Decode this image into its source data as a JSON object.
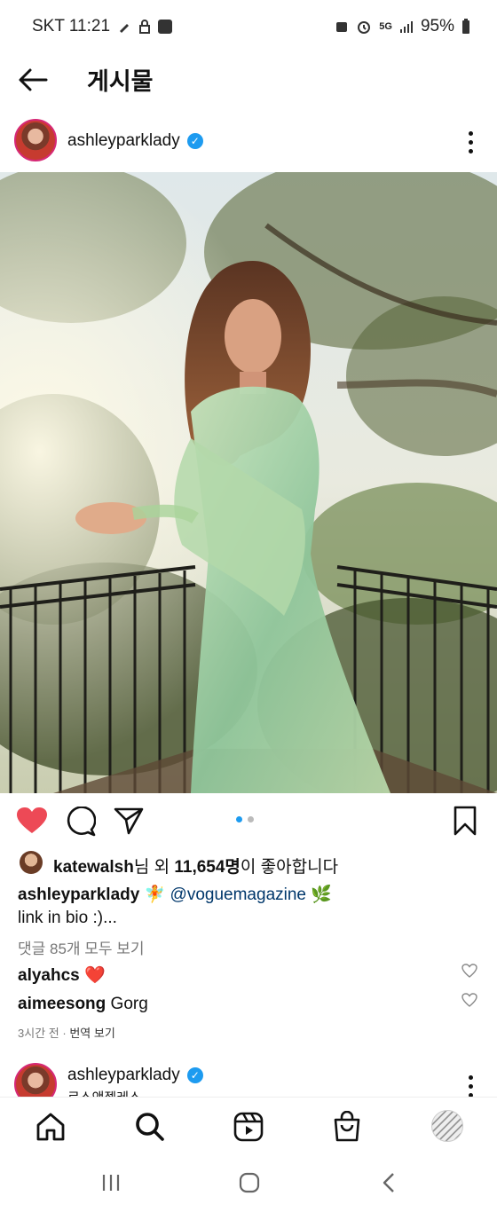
{
  "status": {
    "carrier_time": "SKT 11:21",
    "network": "5G",
    "battery": "95%"
  },
  "header": {
    "title": "게시물"
  },
  "post": {
    "username": "ashleyparklady",
    "verified": "✓",
    "likes": {
      "user": "katewalsh",
      "middle": "님 외 ",
      "count": "11,654명",
      "suffix": "이 좋아합니다"
    },
    "caption": {
      "author": "ashleyparklady",
      "emoji1": "🧚",
      "mention": "@voguemagazine",
      "emoji2": "🌿",
      "line2": "link in bio :)..."
    },
    "view_comments": "댓글 85개 모두 보기",
    "comments": [
      {
        "user": "alyahcs",
        "text": "❤️"
      },
      {
        "user": "aimeesong",
        "text": "Gorg"
      }
    ],
    "time": "3시간 전",
    "separator": "·",
    "translate": "번역 보기"
  },
  "next_post": {
    "username": "ashleyparklady",
    "location": "로스앤젤레스"
  },
  "colors": {
    "like_red": "#ed4956",
    "verified_blue": "#1d9bf0",
    "mention_blue": "#00376b"
  },
  "icons": {
    "nav": [
      "home-icon",
      "search-icon",
      "reels-icon",
      "shop-icon",
      "profile-avatar"
    ],
    "system": [
      "recents-icon",
      "home-circle-icon",
      "back-icon"
    ]
  }
}
